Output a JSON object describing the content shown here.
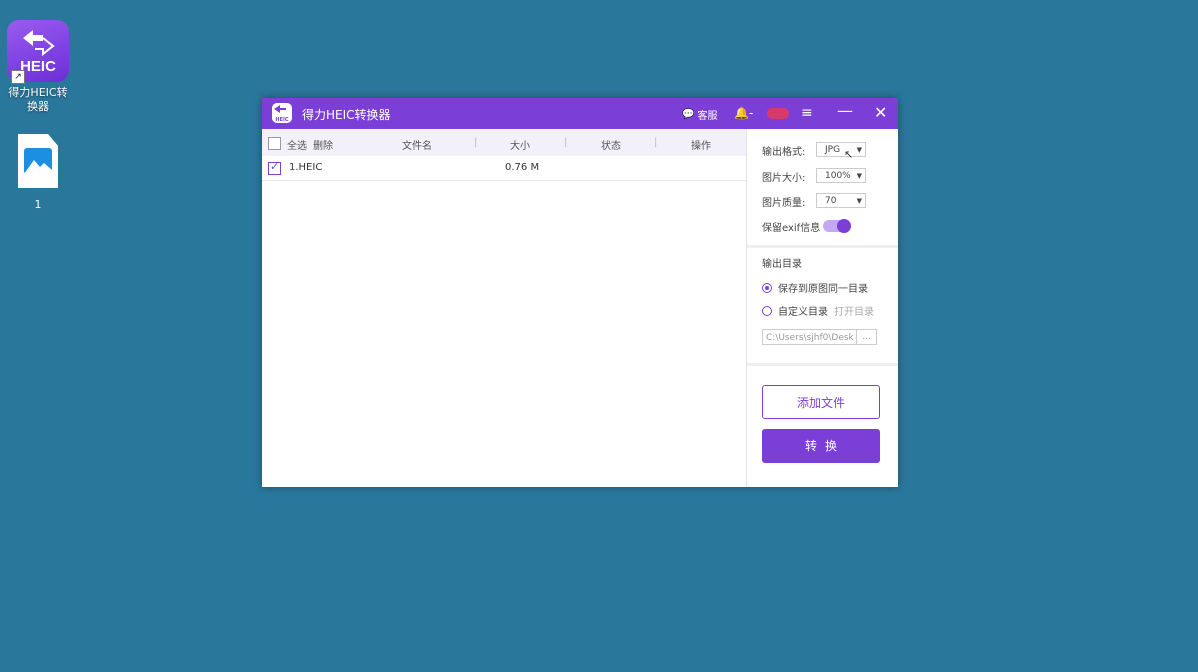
{
  "desktop": {
    "app_icon_text": "HEIC",
    "app_label": "得力HEIC转换器",
    "file_label": "1"
  },
  "window": {
    "title": "得力HEIC转换器",
    "logo_text": "HEIC",
    "service_label": "客服",
    "bell_suffix": "-",
    "menu_glyph": "≡",
    "min_glyph": "—",
    "close_glyph": "✕"
  },
  "file_list": {
    "headers": {
      "select_all": "全选",
      "delete": "删除",
      "filename": "文件名",
      "size": "大小",
      "status": "状态",
      "action": "操作"
    },
    "rows": [
      {
        "checked": true,
        "name": "1.HEIC",
        "size": "0.76 M",
        "status": "",
        "action": ""
      }
    ]
  },
  "settings": {
    "format_label": "输出格式:",
    "format_value": "JPG",
    "size_label": "图片大小:",
    "size_value": "100%",
    "quality_label": "图片质量:",
    "quality_value": "70",
    "exif_label": "保留exif信息",
    "exif_on": true,
    "output_dir_title": "输出目录",
    "radio_same": "保存到原图同一目录",
    "radio_custom": "自定义目录",
    "open_dir": "打开目录",
    "path_value": "C:\\Users\\sjhf0\\Desk",
    "browse": "...",
    "add_file": "添加文件",
    "convert": "转换"
  },
  "colors": {
    "accent": "#7b3fd8",
    "desktop": "#2a779c"
  }
}
